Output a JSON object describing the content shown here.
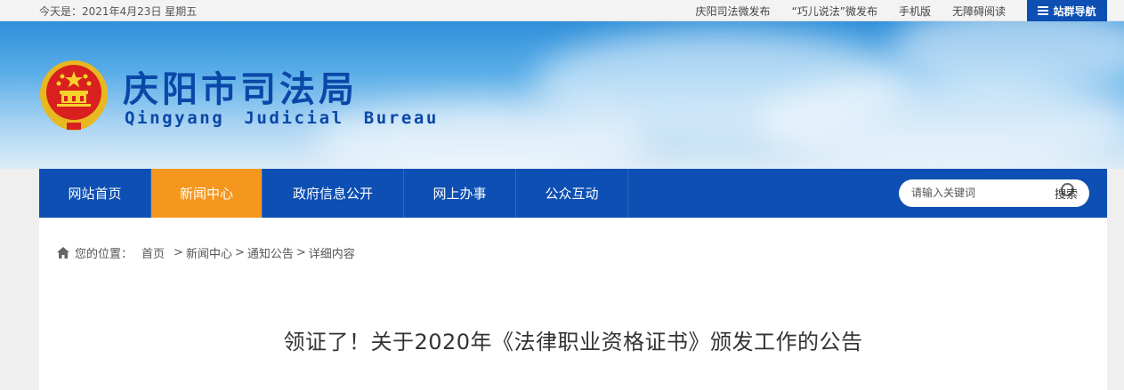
{
  "topbar": {
    "date_text": "今天是：2021年4月23日 星期五",
    "links": [
      "庆阳司法微发布",
      "“巧儿说法”微发布",
      "手机版",
      "无障碍阅读"
    ],
    "sitenav_label": "站群导航"
  },
  "banner": {
    "title": "庆阳市司法局",
    "subtitle": "Qingyang Judicial Bureau"
  },
  "nav": {
    "items": [
      {
        "label": "网站首页",
        "active": false
      },
      {
        "label": "新闻中心",
        "active": true
      },
      {
        "label": "政府信息公开",
        "active": false
      },
      {
        "label": "网上办事",
        "active": false
      },
      {
        "label": "公众互动",
        "active": false
      }
    ],
    "search_placeholder": "请输入关键词",
    "search_button": "搜索"
  },
  "breadcrumb": {
    "label": "您的位置：",
    "items": [
      "首页",
      "新闻中心",
      "通知公告",
      "详细内容"
    ],
    "separator": ">"
  },
  "article": {
    "title": "领证了！关于2020年《法律职业资格证书》颁发工作的公告"
  },
  "colors": {
    "nav_blue": "#0d4fb3",
    "nav_active": "#f5961e",
    "title_blue": "#0a48a8"
  }
}
